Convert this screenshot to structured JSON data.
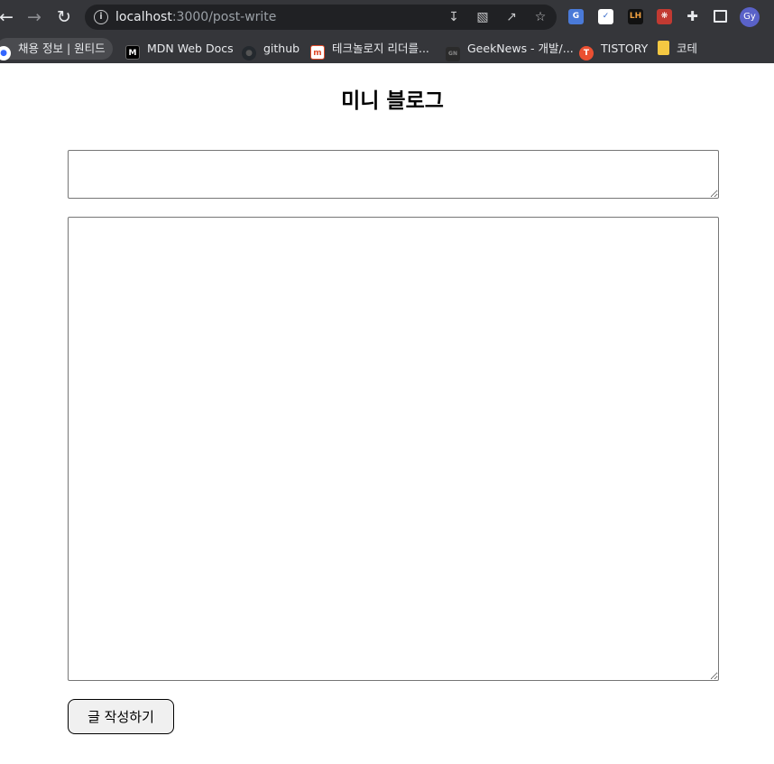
{
  "browser": {
    "url_host": "localhost",
    "url_path": ":3000/post-write",
    "avatar_initials": "Gy",
    "bookmarks": [
      {
        "label": "채용 정보 | 원티드",
        "icon": "wanted-icon"
      },
      {
        "label": "MDN Web Docs",
        "icon": "mdn-icon"
      },
      {
        "label": "github",
        "icon": "github-icon"
      },
      {
        "label": "테크놀로지 리더를...",
        "icon": "tech-leader-icon"
      },
      {
        "label": "GeekNews - 개발/...",
        "icon": "geeknews-icon"
      },
      {
        "label": "TISTORY",
        "icon": "tistory-icon"
      },
      {
        "label": "코테",
        "icon": "folder-icon"
      }
    ]
  },
  "page": {
    "title": "미니 블로그",
    "title_field_value": "",
    "content_field_value": "",
    "submit_label": "글 작성하기"
  },
  "colors": {
    "chrome_bg": "#35363a",
    "omnibox_bg": "#202124",
    "avatar_bg": "#5a62c8"
  }
}
